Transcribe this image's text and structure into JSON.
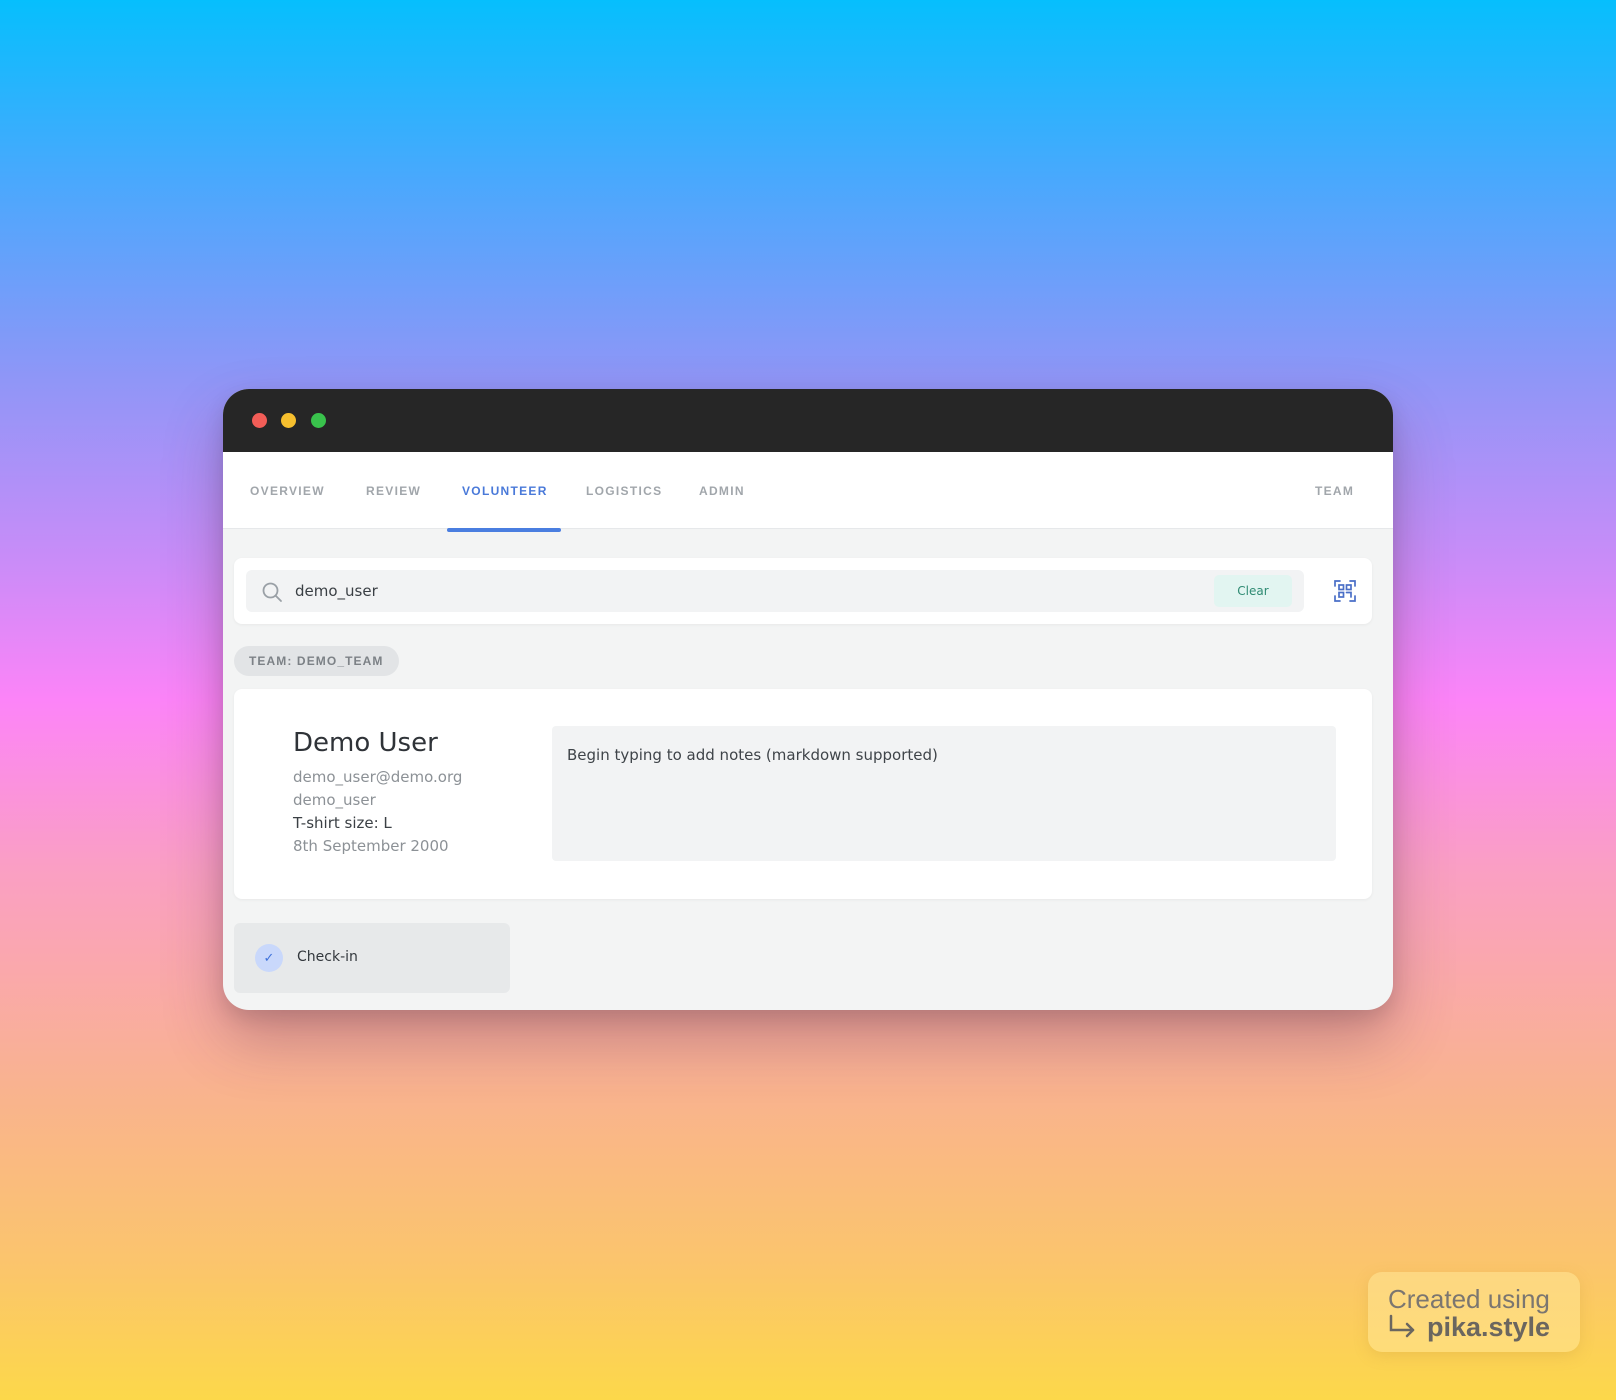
{
  "window": {
    "controls": [
      "close",
      "minimize",
      "maximize"
    ]
  },
  "nav": {
    "tabs": [
      {
        "label": "OVERVIEW",
        "active": false
      },
      {
        "label": "REVIEW",
        "active": false
      },
      {
        "label": "VOLUNTEER",
        "active": true
      },
      {
        "label": "LOGISTICS",
        "active": false
      },
      {
        "label": "ADMIN",
        "active": false
      }
    ],
    "right_tab": "TEAM"
  },
  "search": {
    "value": "demo_user",
    "clear_label": "Clear",
    "icon": "search-icon",
    "scan_icon": "qr-scan-icon"
  },
  "team_badge": "TEAM: DEMO_TEAM",
  "user": {
    "name": "Demo User",
    "email": "demo_user@demo.org",
    "username": "demo_user",
    "tshirt": "T-shirt size: L",
    "date": "8th September 2000"
  },
  "notes": {
    "placeholder": "Begin typing to add notes (markdown supported)"
  },
  "checkin": {
    "label": "Check-in",
    "icon": "check-icon"
  },
  "watermark": {
    "line1": "Created using",
    "line2": "pika.style"
  },
  "colors": {
    "accent": "#4a7ee0",
    "clear_bg": "#e2f5f1",
    "titlebar": "#262626"
  }
}
